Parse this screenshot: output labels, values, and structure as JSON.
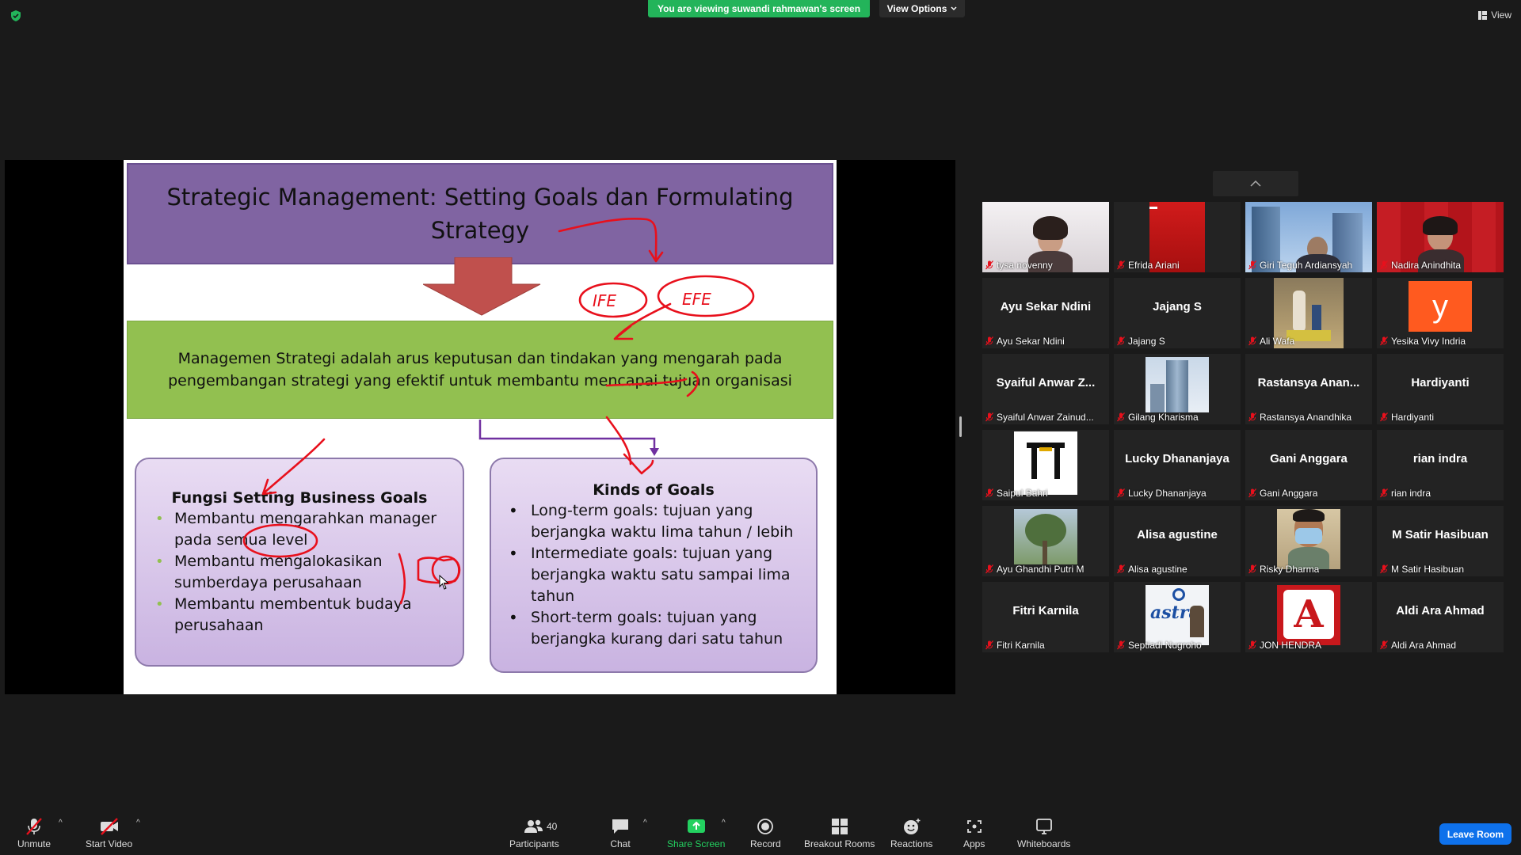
{
  "header": {
    "viewing_banner": "You are viewing suwandi rahmawan's screen",
    "view_options": "View Options",
    "view_label": "View"
  },
  "slide": {
    "title": "Strategic Management: Setting Goals dan Formulating Strategy",
    "definition": "Managemen Strategi adalah arus keputusan dan tindakan yang mengarah pada pengembangan strategi yang efektif untuk membantu mencapai tujuan organisasi",
    "left_card": {
      "heading": "Fungsi Setting Business Goals",
      "items": [
        "Membantu mengarahkan manager pada semua level",
        "Membantu mengalokasikan sumberdaya perusahaan",
        "Membantu membentuk budaya perusahaan"
      ]
    },
    "right_card": {
      "heading": "Kinds of Goals",
      "items": [
        "Long-term goals: tujuan yang berjangka waktu lima tahun / lebih",
        "Intermediate goals: tujuan yang berjangka waktu satu sampai lima tahun",
        "Short-term goals: tujuan yang berjangka kurang dari satu tahun"
      ]
    },
    "annotation_texts": [
      "IFE",
      "EFE"
    ]
  },
  "participants": [
    {
      "name": "tysa novenny",
      "display": "",
      "video": "person-light"
    },
    {
      "name": "Efrida Ariani",
      "display": "",
      "video": "red-screen"
    },
    {
      "name": "Giri Teguh Ardiansyah",
      "display": "",
      "video": "building-sky"
    },
    {
      "name": "Nadira Anindhita",
      "display": "",
      "video": "person-red"
    },
    {
      "name": "Ayu Sekar Ndini",
      "display": "Ayu Sekar Ndini",
      "video": ""
    },
    {
      "name": "Jajang S",
      "display": "Jajang S",
      "video": ""
    },
    {
      "name": "Ali Wafa",
      "display": "",
      "video": "statue-photo"
    },
    {
      "name": "Yesika Vivy Indria",
      "display": "",
      "video": "letter-avatar",
      "avatar_letter": "y"
    },
    {
      "name": "Syaiful Anwar Zainud...",
      "display": "Syaiful Anwar Z...",
      "video": ""
    },
    {
      "name": "Gilang Kharisma",
      "display": "",
      "video": "tower-photo"
    },
    {
      "name": "Rastansya Anandhika",
      "display": "Rastansya Anan...",
      "video": ""
    },
    {
      "name": "Hardiyanti",
      "display": "Hardiyanti",
      "video": ""
    },
    {
      "name": "Saipul Bahri",
      "display": "",
      "video": "gate-logo"
    },
    {
      "name": "Lucky Dhananjaya",
      "display": "Lucky Dhananjaya",
      "video": ""
    },
    {
      "name": "Gani Anggara",
      "display": "Gani Anggara",
      "video": ""
    },
    {
      "name": "rian indra",
      "display": "rian indra",
      "video": ""
    },
    {
      "name": "Ayu Ghandhi Putri M",
      "display": "",
      "video": "tree-photo"
    },
    {
      "name": "Alisa agustine",
      "display": "Alisa agustine",
      "video": ""
    },
    {
      "name": "Risky Dharma",
      "display": "",
      "video": "person-mask"
    },
    {
      "name": "M Satir Hasibuan",
      "display": "M Satir Hasibuan",
      "video": ""
    },
    {
      "name": "Fitri Karnila",
      "display": "Fitri Karnila",
      "video": ""
    },
    {
      "name": "Septiadi Nugroho",
      "display": "",
      "video": "astra-logo"
    },
    {
      "name": "JON HENDRA",
      "display": "",
      "video": "letter-a-logo"
    },
    {
      "name": "Aldi Ara Ahmad",
      "display": "Aldi Ara Ahmad",
      "video": ""
    }
  ],
  "toolbar": {
    "unmute": "Unmute",
    "start_video": "Start Video",
    "participants": "Participants",
    "participant_count": "40",
    "chat": "Chat",
    "share_screen": "Share Screen",
    "record": "Record",
    "breakout_rooms": "Breakout Rooms",
    "reactions": "Reactions",
    "apps": "Apps",
    "whiteboards": "Whiteboards",
    "leave_room": "Leave Room"
  },
  "colors": {
    "share_green": "#23b45a",
    "slide_title_purple": "#8064a2",
    "slide_green": "#92c050",
    "annotation_red": "#e8101c",
    "leave_blue": "#0e71eb"
  }
}
